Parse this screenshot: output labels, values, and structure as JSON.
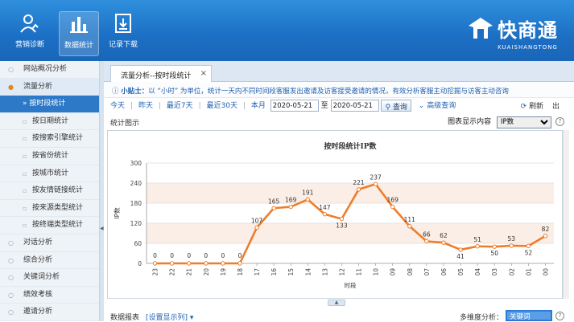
{
  "topnav": [
    {
      "label": "营销诊断",
      "icon": "person-chart-icon"
    },
    {
      "label": "数据统计",
      "icon": "bar-chart-icon",
      "active": true
    },
    {
      "label": "记录下载",
      "icon": "download-icon"
    }
  ],
  "brand": {
    "name": "快商通",
    "en": "KUAISHANGTONG"
  },
  "sidebar": {
    "items": [
      {
        "label": "网站概况分析"
      },
      {
        "label": "流量分析",
        "expanded": true
      },
      {
        "label": "» 按时段统计",
        "sub": true,
        "active": true
      },
      {
        "label": "按日期统计",
        "sub": true
      },
      {
        "label": "按搜索引擎统计",
        "sub": true
      },
      {
        "label": "按省份统计",
        "sub": true
      },
      {
        "label": "按城市统计",
        "sub": true
      },
      {
        "label": "按友情链接统计",
        "sub": true
      },
      {
        "label": "按来源类型统计",
        "sub": true
      },
      {
        "label": "按终端类型统计",
        "sub": true
      },
      {
        "label": "对话分析"
      },
      {
        "label": "综合分析"
      },
      {
        "label": "关键词分析"
      },
      {
        "label": "绩效考核"
      },
      {
        "label": "邀请分析"
      }
    ]
  },
  "tab": {
    "label": "流量分析--按时段统计",
    "close": "×"
  },
  "tip": {
    "label": "小贴士：",
    "text": "以 “小时” 为单位，统计一天内不同时间段客服发出邀请及访客接受邀请的情况，有效分析客服主动挖掘与访客主动咨询"
  },
  "filter": {
    "today": "今天",
    "yesterday": "昨天",
    "last7": "最近7天",
    "last30": "最近30天",
    "month": "本月",
    "from": "2020-05-21",
    "to_label": "至",
    "to": "2020-05-21",
    "query": "查询",
    "advanced": "高级查询",
    "refresh": "刷新",
    "export": "出"
  },
  "chart_section": {
    "title": "统计图示",
    "display_label": "图表显示内容",
    "display_value": "IP数",
    "help": "?"
  },
  "chart_data": {
    "type": "line",
    "title": "按时段统计IP数",
    "xlabel": "时段",
    "ylabel": "IP数",
    "ylim": [
      0,
      300
    ],
    "yticks": [
      0,
      60,
      120,
      180,
      240,
      300
    ],
    "categories": [
      "23",
      "22",
      "21",
      "20",
      "19",
      "18",
      "17",
      "16",
      "15",
      "14",
      "13",
      "12",
      "11",
      "10",
      "09",
      "08",
      "07",
      "06",
      "05",
      "04",
      "03",
      "02",
      "01",
      "00"
    ],
    "values": [
      0,
      0,
      0,
      0,
      0,
      0,
      107,
      165,
      169,
      191,
      147,
      133,
      221,
      237,
      169,
      111,
      66,
      62,
      41,
      51,
      50,
      53,
      52,
      82
    ],
    "color": "#ee7d2a"
  },
  "bottom": {
    "report": "数据报表",
    "columns_link": "[设置显示列] ▾",
    "multi": "多维度分析：",
    "keyword": "关键词",
    "help": "?"
  }
}
